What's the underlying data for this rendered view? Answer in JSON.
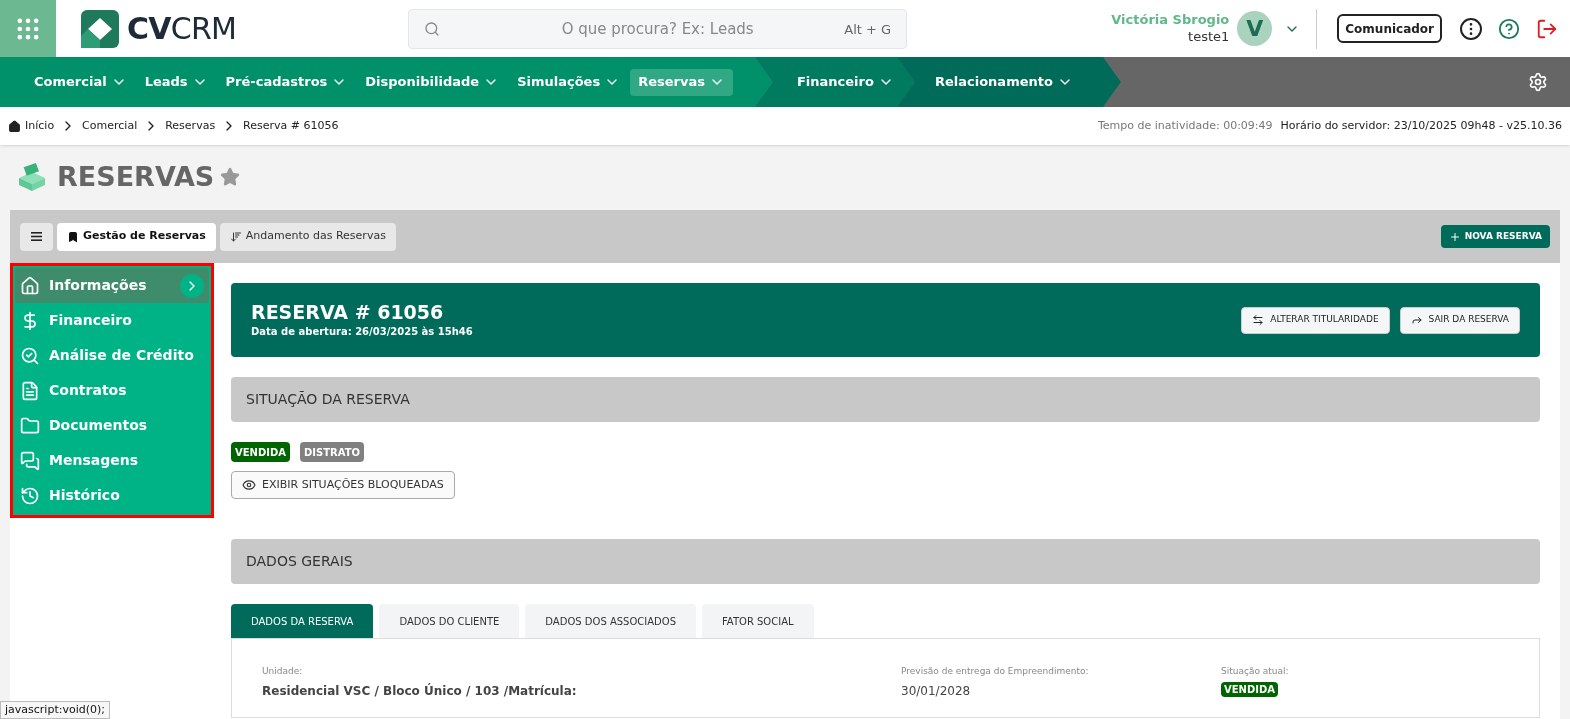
{
  "header": {
    "logo": "**CV**CRM",
    "search_placeholder": "O que procura? Ex: Leads",
    "search_shortcut": "Alt + G",
    "user_name": "Victória Sbrogio",
    "user_login": "teste1",
    "avatar_initial": "V",
    "communicator_button": "Comunicador"
  },
  "nav": [
    {
      "label": "Comercial",
      "selected": false
    },
    {
      "label": "Leads",
      "selected": false
    },
    {
      "label": "Pré-cadastros",
      "selected": false
    },
    {
      "label": "Disponibilidade",
      "selected": false
    },
    {
      "label": "Simulações",
      "selected": false
    },
    {
      "label": "Reservas",
      "selected": true
    },
    {
      "label": "Financeiro",
      "selected": false
    },
    {
      "label": "Relacionamento",
      "selected": false
    }
  ],
  "breadcrumb": [
    "Início",
    "Comercial",
    "Reservas",
    "Reserva # 61056"
  ],
  "inactivity": "Tempo de inatividade: 00:09:49",
  "server_time": "Horário do servidor: 23/10/2025 09h48 - v25.10.36",
  "page_title": "RESERVAS",
  "toolbar_tabs": [
    {
      "label": "Gestão de Reservas",
      "selected": true
    },
    {
      "label": "Andamento das Reservas",
      "selected": false
    }
  ],
  "new_button": "NOVA RESERVA",
  "sidebar": [
    {
      "label": "Informações",
      "selected": true
    },
    {
      "label": "Financeiro",
      "selected": false
    },
    {
      "label": "Análise de Crédito",
      "selected": false
    },
    {
      "label": "Contratos",
      "selected": false
    },
    {
      "label": "Documentos",
      "selected": false
    },
    {
      "label": "Mensagens",
      "selected": false
    },
    {
      "label": "Histórico",
      "selected": false
    }
  ],
  "reserva": {
    "title": "RESERVA # 61056",
    "opened": "Data de abertura: 26/03/2025 às 15h46",
    "buttons": [
      "ALTERAR TITULARIDADE",
      "SAIR DA RESERVA"
    ]
  },
  "situacao": {
    "title": "SITUAÇÃO DA RESERVA",
    "badges": [
      {
        "label": "VENDIDA",
        "color": "#006400"
      },
      {
        "label": "DISTRATO",
        "color": "#808080"
      }
    ],
    "show_blocked": "EXIBIR SITUAÇÕES BLOQUEADAS"
  },
  "dados_gerais": {
    "title": "DADOS GERAIS",
    "tabs": [
      {
        "label": "DADOS DA RESERVA",
        "selected": true
      },
      {
        "label": "DADOS DO CLIENTE",
        "selected": false
      },
      {
        "label": "DADOS DOS ASSOCIADOS",
        "selected": false
      },
      {
        "label": "FATOR SOCIAL",
        "selected": false
      }
    ],
    "fields": [
      {
        "label": "Unidade:",
        "value": "Residencial VSC / Bloco Único / 103 /Matrícula:",
        "kind": "bold"
      },
      {
        "label": "Previsão de entrega do Empreendimento:",
        "value": "30/01/2028",
        "kind": "text"
      },
      {
        "label": "Situação atual:",
        "value": "VENDIDA",
        "kind": "badge",
        "color": "#006400"
      }
    ]
  },
  "status_tooltip": "javascript:void(0);"
}
